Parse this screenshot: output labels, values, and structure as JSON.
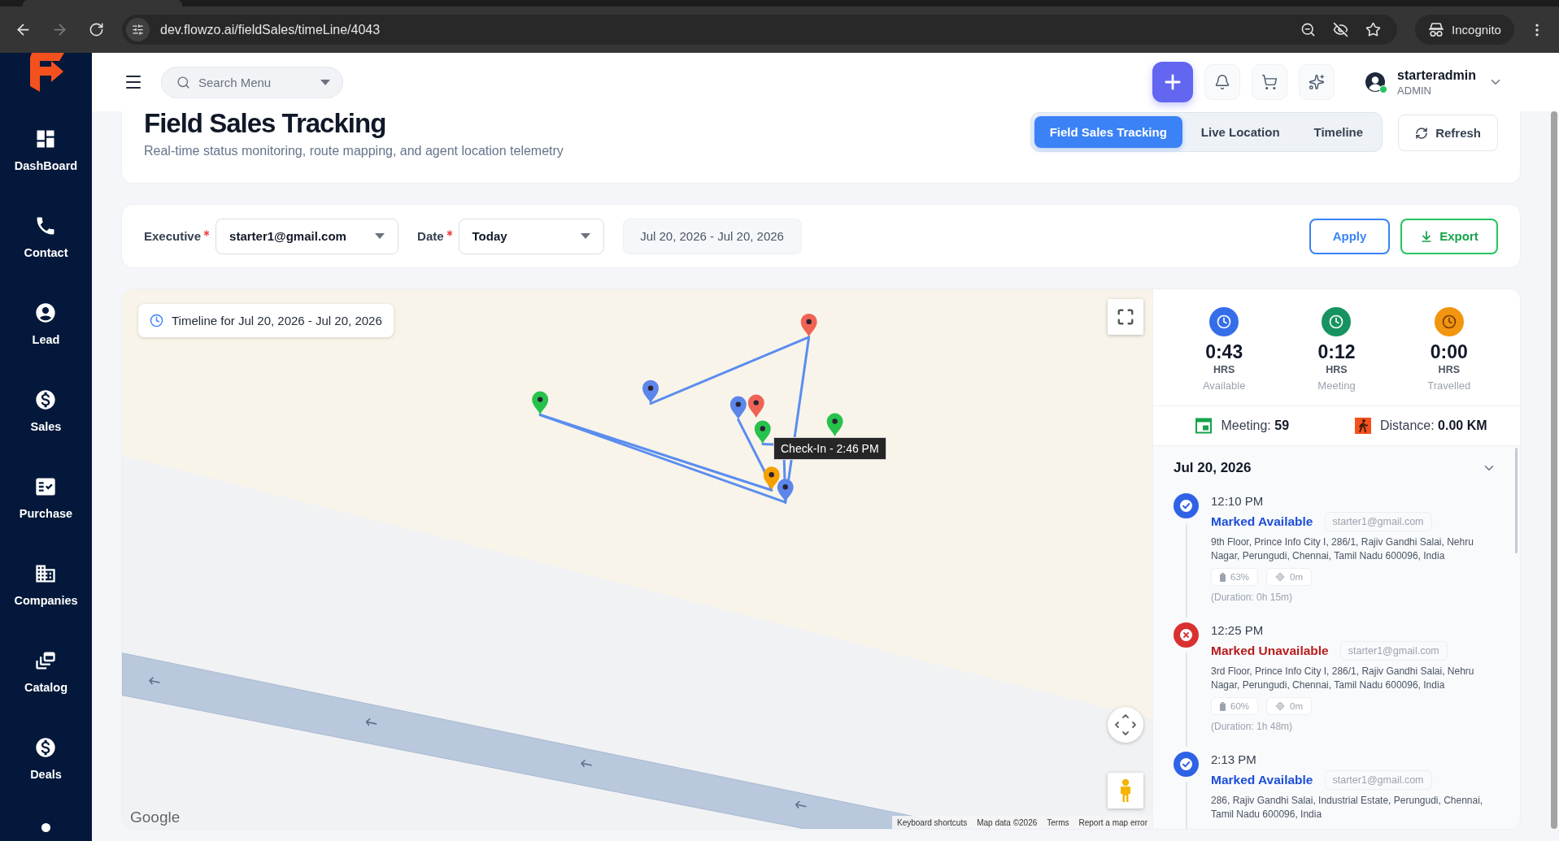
{
  "browser": {
    "url": "dev.flowzo.ai/fieldSales/timeLine/4043",
    "profile": "Incognito",
    "forward_disabled": true
  },
  "sidebar": {
    "items": [
      {
        "label": "DashBoard"
      },
      {
        "label": "Contact"
      },
      {
        "label": "Lead"
      },
      {
        "label": "Sales"
      },
      {
        "label": "Purchase"
      },
      {
        "label": "Companies"
      },
      {
        "label": "Catalog"
      },
      {
        "label": "Deals"
      }
    ]
  },
  "header": {
    "search": {
      "placeholder": "Search Menu"
    },
    "user": {
      "name": "starteradmin",
      "role": "ADMIN",
      "online": true
    }
  },
  "page": {
    "title": "Field Sales Tracking",
    "subtitle": "Real-time status monitoring, route mapping, and agent location telemetry",
    "tabs": [
      {
        "label": "Field Sales Tracking",
        "selected": true
      },
      {
        "label": "Live Location",
        "selected": false
      },
      {
        "label": "Timeline",
        "selected": false
      }
    ],
    "refresh": "Refresh"
  },
  "filters": {
    "fields": [
      {
        "label": "Executive",
        "required": true,
        "value": "starter1@gmail.com"
      },
      {
        "label": "Date",
        "required": true,
        "value": "Today"
      }
    ],
    "range": "Jul 20, 2026 - Jul 20, 2026",
    "apply": "Apply",
    "export": "Export"
  },
  "map": {
    "overlay_title": "Timeline for Jul 20, 2026 - Jul 20, 2026",
    "markers": [
      {
        "color": "#ef6355"
      },
      {
        "color": "#5c86ea"
      },
      {
        "color": "#27c24c"
      },
      {
        "color": "#5c86ea"
      },
      {
        "color": "#ef6355"
      },
      {
        "color": "#27c24c"
      },
      {
        "color": "#27c24c"
      },
      {
        "color": "#f5a000"
      },
      {
        "color": "#5c86ea"
      }
    ],
    "tooltip": "Check-In - 2:46 PM",
    "logo": "Google",
    "attribution": [
      "Keyboard shortcuts",
      "Map data ©2026",
      "Terms",
      "Report a map error"
    ]
  },
  "stats": [
    {
      "value": "0:43",
      "unit": "HRS",
      "label": "Available",
      "color": "#356ee8"
    },
    {
      "value": "0:12",
      "unit": "HRS",
      "label": "Meeting",
      "color": "#16935f"
    },
    {
      "value": "0:00",
      "unit": "HRS",
      "label": "Travelled",
      "color": "#f2950f"
    }
  ],
  "summary": {
    "meeting": "Meeting: **59**",
    "distance": "Distance: **0.00 KM**"
  },
  "timeline": {
    "date": "Jul 20, 2026",
    "expanded": true,
    "entries": [
      {
        "time": "12:10 PM",
        "kind": "available",
        "status": "Marked Available",
        "email": "starter1@gmail.com",
        "address": "9th Floor, Prince Info City I, 286/1, Rajiv Gandhi Salai, Nehru Nagar, Perungudi, Chennai, Tamil Nadu 600096, India",
        "battery": "63%",
        "distance": "0m",
        "duration": "(Duration: 0h 15m)"
      },
      {
        "time": "12:25 PM",
        "kind": "unavailable",
        "status": "Marked Unavailable",
        "email": "starter1@gmail.com",
        "address": "3rd Floor, Prince Info City I, 286/1, Rajiv Gandhi Salai, Nehru Nagar, Perungudi, Chennai, Tamil Nadu 600096, India",
        "battery": "60%",
        "distance": "0m",
        "duration": "(Duration: 1h 48m)"
      },
      {
        "time": "2:13 PM",
        "kind": "available",
        "status": "Marked Available",
        "email": "starter1@gmail.com",
        "address": "286, Rajiv Gandhi Salai, Industrial Estate, Perungudi, Chennai, Tamil Nadu 600096, India"
      }
    ]
  }
}
